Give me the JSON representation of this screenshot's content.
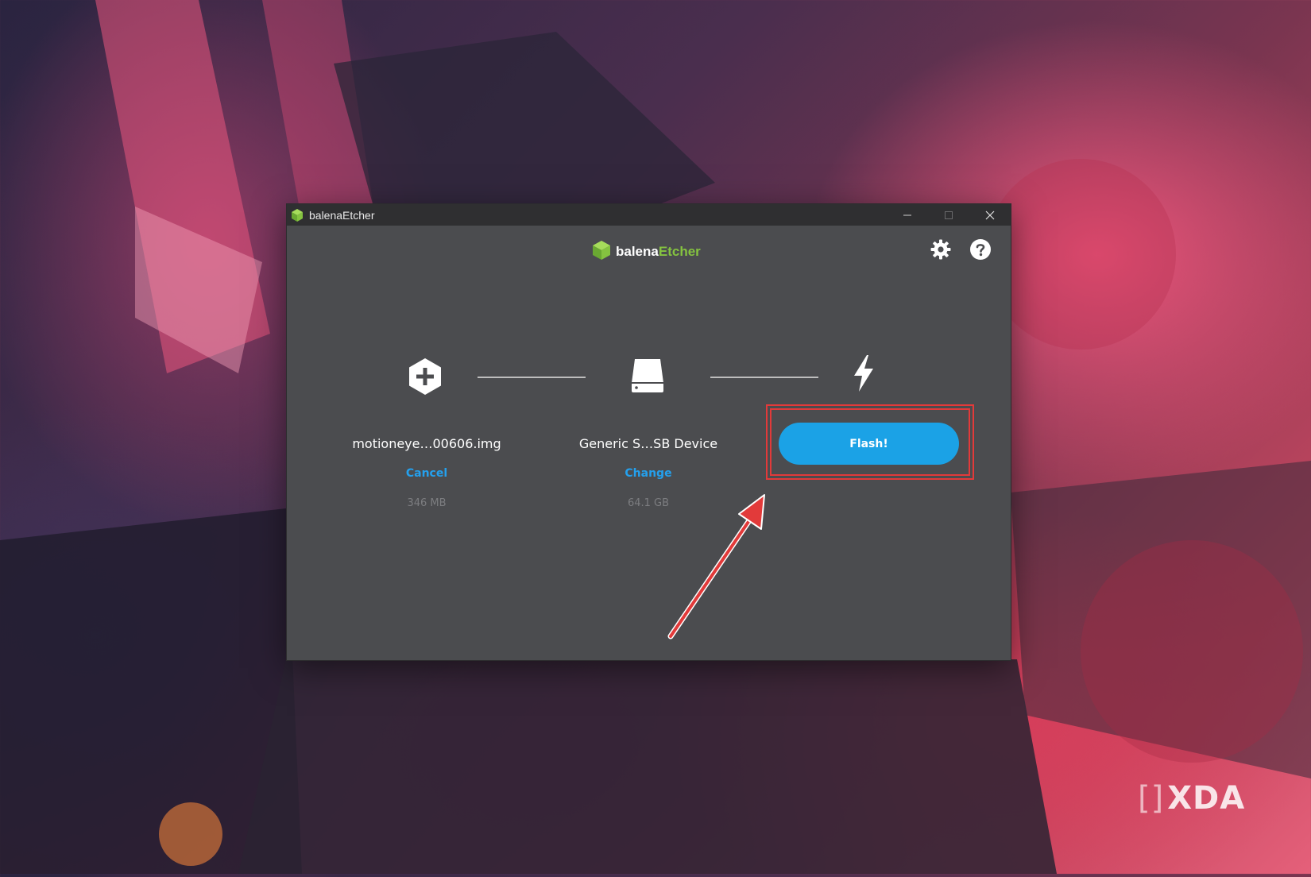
{
  "window": {
    "title": "balenaEtcher"
  },
  "header": {
    "logo_part_a": "balena",
    "logo_part_b": "Etcher"
  },
  "icons": {
    "app": "balena-cube-icon",
    "settings": "gear-icon",
    "help": "question-icon",
    "source": "add-source-icon",
    "target": "drive-icon",
    "flash": "flash-bolt-icon",
    "minimize": "minimize-icon",
    "maximize": "maximize-icon",
    "close": "close-icon"
  },
  "steps": {
    "source": {
      "name": "motioneye…00606.img",
      "action": "Cancel",
      "size": "346 MB"
    },
    "target": {
      "name": "Generic S…SB Device",
      "action": "Change",
      "size": "64.1 GB"
    },
    "flash": {
      "button_label": "Flash!"
    }
  },
  "watermark": {
    "text": "XDA"
  },
  "colors": {
    "accent": "#1ba2e6",
    "link": "#24a0ed",
    "brand_green": "#85c340",
    "highlight": "#e23a3a"
  }
}
